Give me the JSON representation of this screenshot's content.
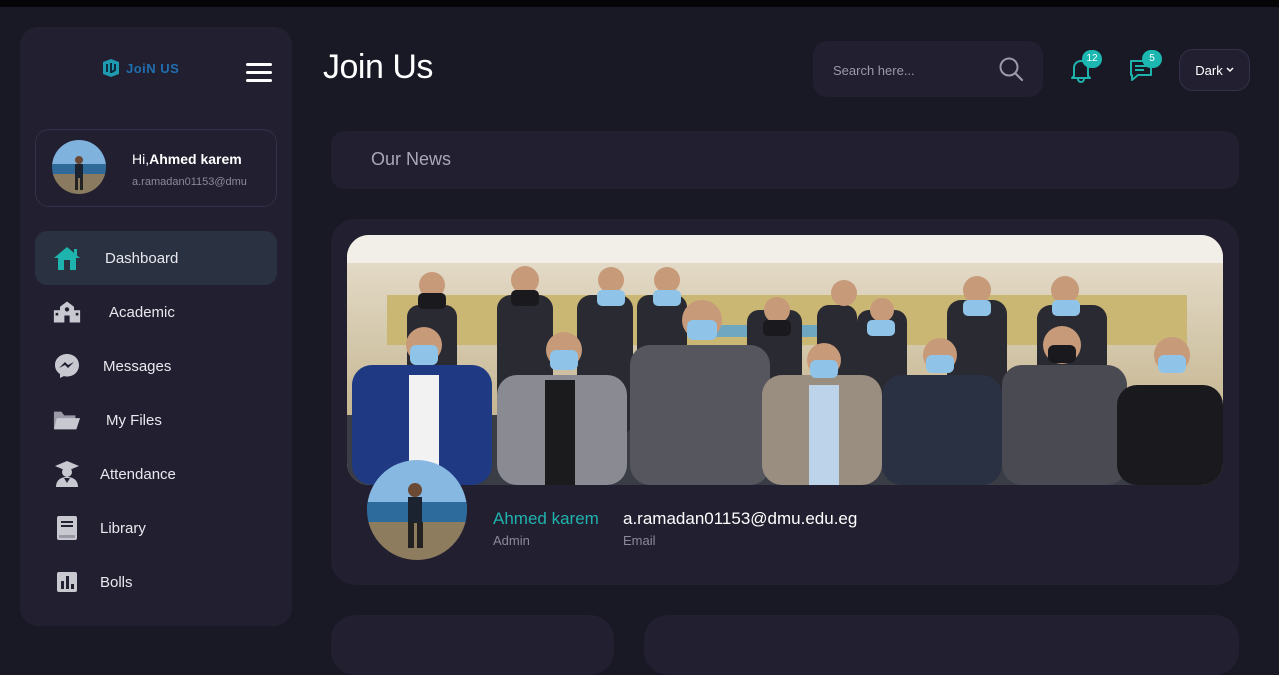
{
  "app": {
    "logo_text": "JoiN US",
    "page_title": "Join Us"
  },
  "sidebar": {
    "greeting_prefix": "Hi,",
    "user_name": "Ahmed karem",
    "user_email": "a.ramadan01153@dmu",
    "items": [
      {
        "label": "Dashboard",
        "icon": "home-icon",
        "active": true
      },
      {
        "label": "Academic",
        "icon": "school-icon"
      },
      {
        "label": "Messages",
        "icon": "messenger-icon"
      },
      {
        "label": "My Files",
        "icon": "folder-icon"
      },
      {
        "label": "Attendance",
        "icon": "graduate-icon"
      },
      {
        "label": "Library",
        "icon": "book-icon"
      },
      {
        "label": "Bolls",
        "icon": "poll-icon"
      }
    ]
  },
  "header": {
    "search_placeholder": "Search here...",
    "notifications_count": "12",
    "messages_count": "5",
    "theme_selected": "Dark"
  },
  "news": {
    "title": "Our News"
  },
  "profile": {
    "name": "Ahmed karem",
    "role": "Admin",
    "email": "a.ramadan01153@dmu.edu.eg",
    "email_label": "Email"
  },
  "colors": {
    "accent": "#1fb3ae",
    "background": "#191825",
    "panel": "#221f30",
    "badge": "#1bb7b0"
  }
}
